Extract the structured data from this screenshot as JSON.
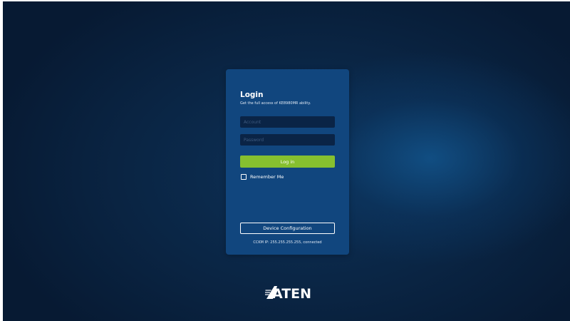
{
  "login": {
    "title": "Login",
    "subtitle": "Get the full access of KE8980MR ability.",
    "account_placeholder": "Account",
    "password_placeholder": "Password",
    "login_button_label": "Log in",
    "remember_label": "Remember Me",
    "remember_checked": false,
    "device_config_label": "Device Configuration",
    "cckm_status": "CCKM IP: 255.255.255.255, connected"
  },
  "brand": {
    "logo_text": "ATEN"
  },
  "colors": {
    "background": "#0a2544",
    "card": "#11467e",
    "accent_green": "#86c02f",
    "input_bg": "#0a2446",
    "text": "#ffffff"
  },
  "icons": {
    "remember_checkbox": "checkbox-empty",
    "logo": "aten-logo"
  }
}
